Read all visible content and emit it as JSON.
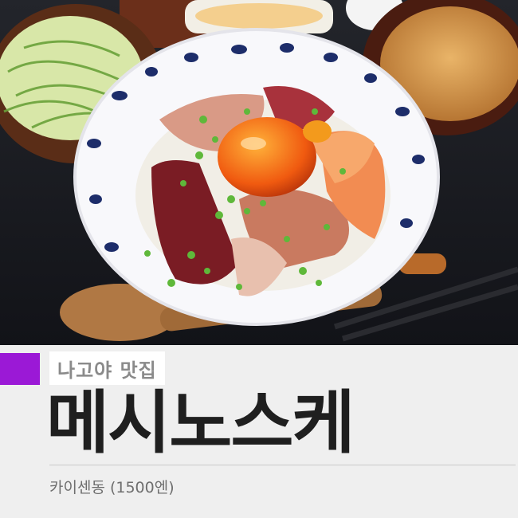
{
  "banner": {
    "subtitle": "나고야 맛집",
    "title": "메시노스케",
    "caption": "카이센동 (1500엔)",
    "accent_color": "#9b19d6"
  },
  "photo": {
    "description_icon": "food-photo"
  }
}
